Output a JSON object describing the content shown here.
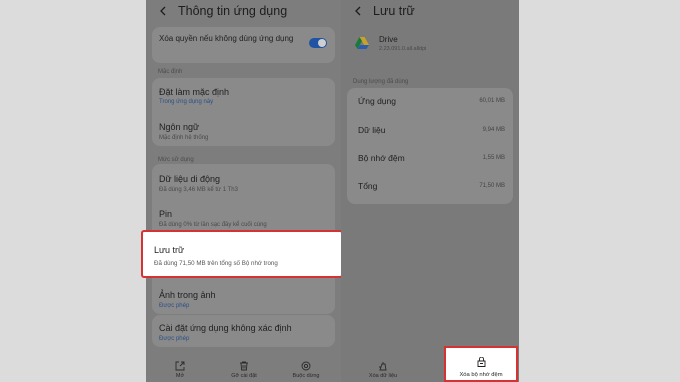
{
  "left": {
    "header_title": "Thông tin ứng dụng",
    "remove_permissions": {
      "label": "Xóa quyền nếu không dùng ứng dụng",
      "enabled": true
    },
    "section_default": "Mặc định",
    "set_default": {
      "title": "Đặt làm mặc định",
      "subtitle": "Trong ứng dụng này"
    },
    "language": {
      "title": "Ngôn ngữ",
      "subtitle": "Mặc định hệ thống"
    },
    "section_usage": "Mức sử dụng",
    "mobile_data": {
      "title": "Dữ liệu di động",
      "subtitle": "Đã dùng 3,46 MB kể từ 1 Th3"
    },
    "battery": {
      "title": "Pin",
      "subtitle": "Đã dùng 0% từ lần sạc đầy kể cuối cùng"
    },
    "storage": {
      "title": "Lưu trữ",
      "subtitle": "Đã dùng 71,50 MB trên tổng số Bộ nhớ trong"
    },
    "picture_in_picture": {
      "title": "Ảnh trong ảnh",
      "subtitle": "Được phép"
    },
    "install_unknown": {
      "title": "Cài đặt ứng dụng không xác định",
      "subtitle": "Được phép"
    },
    "bottom": {
      "open": "Mở",
      "uninstall": "Gỡ cài đặt",
      "force_stop": "Buộc dừng"
    }
  },
  "right": {
    "header_title": "Lưu trữ",
    "app_name": "Drive",
    "app_version": "2.23.091.0.all.alldpi",
    "section_title": "Dung lượng đã dùng",
    "rows": [
      {
        "label": "Ứng dụng",
        "value": "60,01 MB"
      },
      {
        "label": "Dữ liệu",
        "value": "9,94 MB"
      },
      {
        "label": "Bộ nhớ đệm",
        "value": "1,55 MB"
      },
      {
        "label": "Tổng",
        "value": "71,50 MB"
      }
    ],
    "bottom": {
      "clear_data": "Xóa dữ liệu",
      "clear_cache": "Xóa bộ nhớ đệm"
    }
  },
  "colors": {
    "highlight": "#d43333",
    "toggle": "#1f53a3",
    "link": "#2c4f85"
  }
}
